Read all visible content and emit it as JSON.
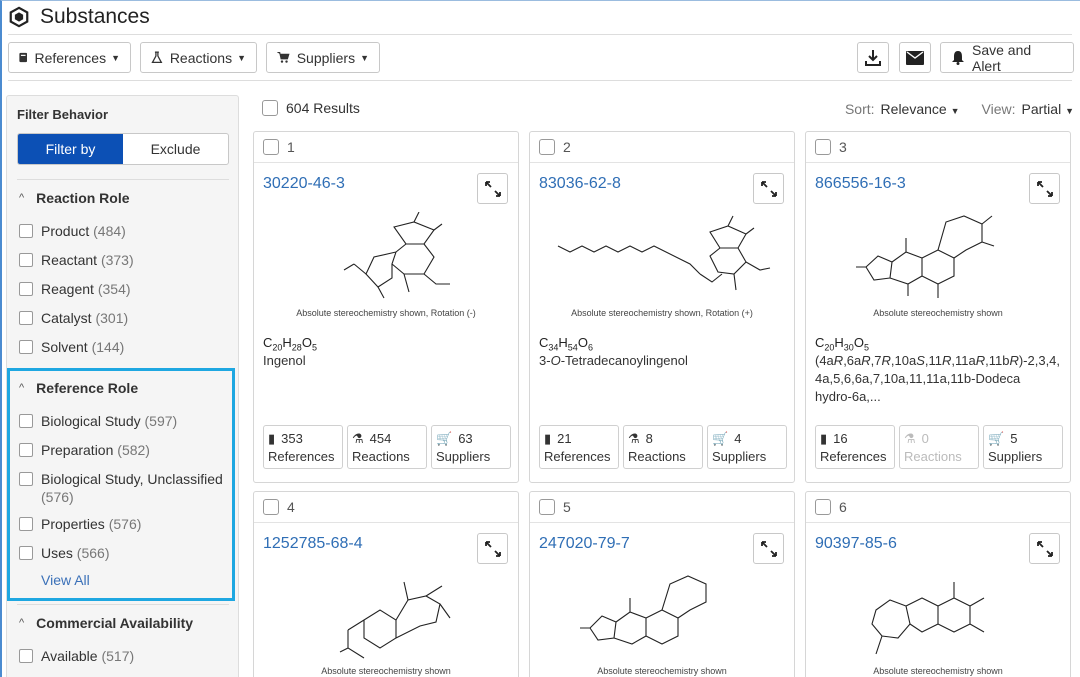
{
  "header": {
    "title": "Substances"
  },
  "toolbar": {
    "references_label": "References",
    "reactions_label": "Reactions",
    "suppliers_label": "Suppliers",
    "save_alert_label": "Save and Alert"
  },
  "sidebar": {
    "filter_behavior_title": "Filter Behavior",
    "filter_by_label": "Filter by",
    "exclude_label": "Exclude",
    "reaction_role": {
      "title": "Reaction Role",
      "items": [
        {
          "label": "Product",
          "count": "(484)"
        },
        {
          "label": "Reactant",
          "count": "(373)"
        },
        {
          "label": "Reagent",
          "count": "(354)"
        },
        {
          "label": "Catalyst",
          "count": "(301)"
        },
        {
          "label": "Solvent",
          "count": "(144)"
        }
      ]
    },
    "reference_role": {
      "title": "Reference Role",
      "items": [
        {
          "label": "Biological Study",
          "count": "(597)"
        },
        {
          "label": "Preparation",
          "count": "(582)"
        },
        {
          "label": "Biological Study, Unclassified",
          "count": "(576)"
        },
        {
          "label": "Properties",
          "count": "(576)"
        },
        {
          "label": "Uses",
          "count": "(566)"
        }
      ],
      "view_all": "View All"
    },
    "commercial_availability": {
      "title": "Commercial Availability",
      "items": [
        {
          "label": "Available",
          "count": "(517)"
        }
      ]
    }
  },
  "results": {
    "count_label": "604 Results",
    "sort_label": "Sort:",
    "sort_value": "Relevance",
    "view_label": "View:",
    "view_value": "Partial"
  },
  "cards": [
    {
      "index": "1",
      "cas": "30220-46-3",
      "stereo": "Absolute stereochemistry shown, Rotation (-)",
      "formula": [
        "C",
        "20",
        "H",
        "28",
        "O",
        "5"
      ],
      "name": "Ingenol",
      "refs": "353",
      "refs_label": "References",
      "rxns": "454",
      "rxns_label": "Reactions",
      "sups": "63",
      "sups_label": "Suppliers"
    },
    {
      "index": "2",
      "cas": "83036-62-8",
      "stereo": "Absolute stereochemistry shown, Rotation (+)",
      "formula": [
        "C",
        "34",
        "H",
        "54",
        "O",
        "6"
      ],
      "name_prefix": "3-",
      "name_italic": "O",
      "name_rest": "-Tetradecanoylingenol",
      "refs": "21",
      "refs_label": "References",
      "rxns": "8",
      "rxns_label": "Reactions",
      "sups": "4",
      "sups_label": "Suppliers"
    },
    {
      "index": "3",
      "cas": "866556-16-3",
      "stereo": "Absolute stereochemistry shown",
      "formula": [
        "C",
        "20",
        "H",
        "30",
        "O",
        "5"
      ],
      "name_parts": [
        "(4a",
        "R",
        ",6a",
        "R",
        ",7",
        "R",
        ",10a",
        "S",
        ",11",
        "R",
        ",11a",
        "R",
        ",11b",
        "R",
        ")-2,3,4,"
      ],
      "name_line2": "4a,5,6,6a,7,10a,11,11a,11b-Dodeca",
      "name_line3": "hydro-6a,...",
      "refs": "16",
      "refs_label": "References",
      "rxns": "0",
      "rxns_label": "Reactions",
      "sups": "5",
      "sups_label": "Suppliers"
    },
    {
      "index": "4",
      "cas": "1252785-68-4",
      "stereo": "Absolute stereochemistry shown"
    },
    {
      "index": "5",
      "cas": "247020-79-7",
      "stereo": "Absolute stereochemistry shown"
    },
    {
      "index": "6",
      "cas": "90397-85-6",
      "stereo": "Absolute stereochemistry shown"
    }
  ],
  "colors": {
    "accent": "#0c50b5",
    "link": "#2f6eb5",
    "highlight": "#1ea7e1"
  }
}
